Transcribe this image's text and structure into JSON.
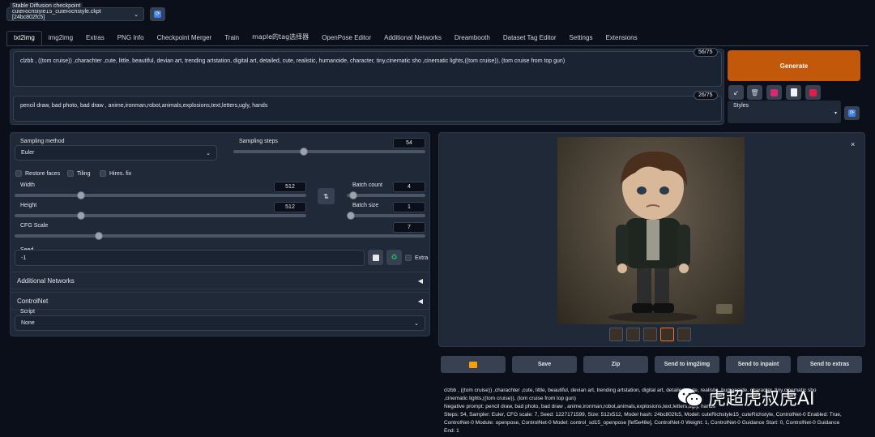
{
  "checkpoint": {
    "label": "Stable Diffusion checkpoint",
    "value": "cuteRichstyle15_cuteRichstyle.ckpt [24bc802fc5]",
    "refresh_icon": "refresh-icon"
  },
  "tabs": [
    "txt2img",
    "img2img",
    "Extras",
    "PNG Info",
    "Checkpoint Merger",
    "Train",
    "maple的tag选择器",
    "OpenPose Editor",
    "Additional Networks",
    "Dreambooth",
    "Dataset Tag Editor",
    "Settings",
    "Extensions"
  ],
  "prompt": {
    "text": "clzbb , ((tom cruise)) ,charachter ,cute, little, beautiful, devian art, trending artstation, digital art, detailed, cute, realistic, humanoide, character, tiny,cinematic sho ,cinematic lights,((tom cruise)), (tom cruise from top gun)",
    "counter": "56/75"
  },
  "negative": {
    "text": "pencil draw, bad photo, bad draw , anime,ironman,robot,animals,explosions,text,letters,ugly, hands",
    "counter": "26/75"
  },
  "generate_label": "Generate",
  "tool_icons": [
    "arrow-icon",
    "trash-icon",
    "style-icon",
    "clipboard-icon",
    "save-icon"
  ],
  "styles": {
    "label": "Styles"
  },
  "sampling": {
    "method_label": "Sampling method",
    "method_value": "Euler",
    "steps_label": "Sampling steps",
    "steps_value": "54",
    "steps_fraction": 0.36
  },
  "checkboxes": {
    "restore_faces": "Restore faces",
    "tiling": "Tiling",
    "hires": "Hires. fix"
  },
  "width": {
    "label": "Width",
    "value": "512",
    "fraction": 0.22
  },
  "height": {
    "label": "Height",
    "value": "512",
    "fraction": 0.22
  },
  "batch_count": {
    "label": "Batch count",
    "value": "4",
    "fraction": 0.03
  },
  "batch_size": {
    "label": "Batch size",
    "value": "1",
    "fraction": 0.0
  },
  "cfg": {
    "label": "CFG Scale",
    "value": "7",
    "fraction": 0.2
  },
  "seed": {
    "label": "Seed",
    "value": "-1",
    "extra_label": "Extra"
  },
  "accordions": {
    "additional_networks": "Additional Networks",
    "controlnet": "ControlNet"
  },
  "script": {
    "label": "Script",
    "value": "None"
  },
  "output_buttons": {
    "folder_icon": "folder-icon",
    "save": "Save",
    "zip": "Zip",
    "send_img2img": "Send to img2img",
    "send_inpaint": "Send to inpaint",
    "send_extras": "Send to extras"
  },
  "info_lines": [
    "clzbb , ((tom cruise)) ,charachter ,cute, little, beautiful, devian art, trending artstation, digital art, detailed, cute, realistic, humanoide, character, tiny,cinematic sho",
    ",cinematic lights,((tom cruise)), (tom cruise from top gun)",
    "Negative prompt: pencil draw, bad photo, bad draw , anime,ironman,robot,animals,explosions,text,letters,ugly, hands",
    "Steps: 54, Sampler: Euler, CFG scale: 7, Seed: 1227171599, Size: 512x512, Model hash: 24bc802fc5, Model: cuteRichstyle15_cuteRichstyle, ControlNet-0 Enabled: True,",
    "ControlNet-0 Module: openpose, ControlNet-0 Model: control_sd15_openpose [fef5e48e], ControlNet-0 Weight: 1, ControlNet-0 Guidance Start: 0, ControlNet-0 Guidance",
    "End: 1"
  ],
  "watermark": "虎超虎叔虎AI",
  "colors": {
    "accent": "#c2590a",
    "background": "#0b0f19",
    "panel": "#1f2937"
  }
}
